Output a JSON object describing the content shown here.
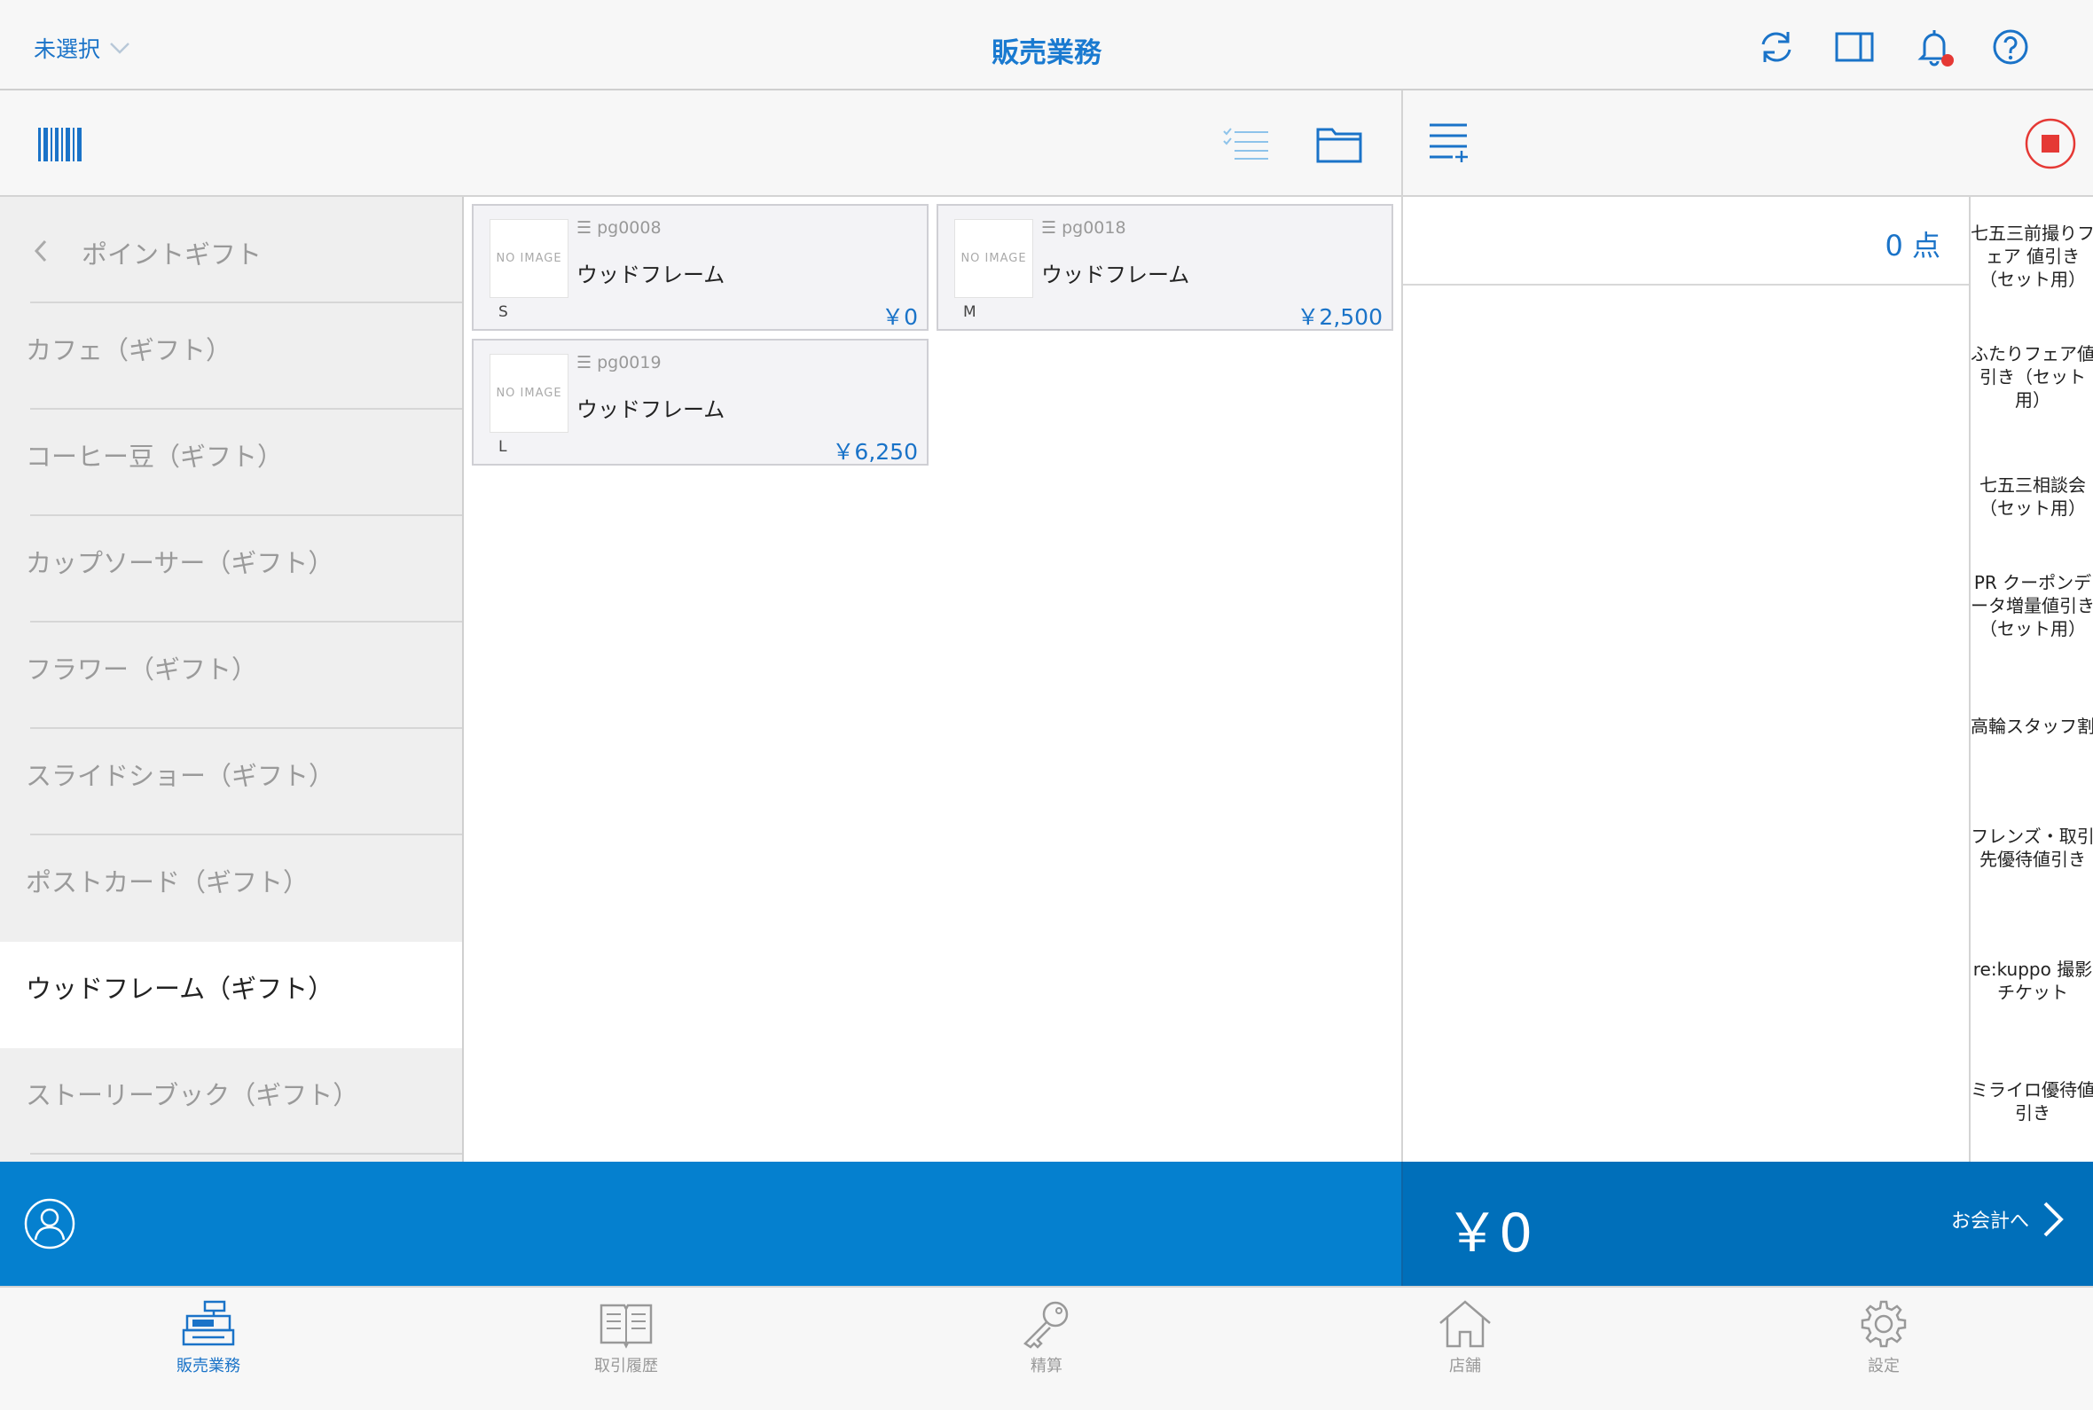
{
  "header": {
    "store_selector": "未選択",
    "title": "販売業務"
  },
  "categories": {
    "back_label": "ポイントギフト",
    "items": [
      {
        "label": "カフェ（ギフト）",
        "selected": false
      },
      {
        "label": "コーヒー豆（ギフト）",
        "selected": false
      },
      {
        "label": "カップソーサー（ギフト）",
        "selected": false
      },
      {
        "label": "フラワー（ギフト）",
        "selected": false
      },
      {
        "label": "スライドショー（ギフト）",
        "selected": false
      },
      {
        "label": "ポストカード（ギフト）",
        "selected": false
      },
      {
        "label": "ウッドフレーム（ギフト）",
        "selected": true
      },
      {
        "label": "ストーリーブック（ギフト）",
        "selected": false
      }
    ]
  },
  "products": [
    {
      "code": "pg0008",
      "name": "ウッドフレーム",
      "size": "S",
      "price": "￥0",
      "image": "NO IMAGE"
    },
    {
      "code": "pg0018",
      "name": "ウッドフレーム",
      "size": "M",
      "price": "￥2,500",
      "image": "NO IMAGE"
    },
    {
      "code": "pg0019",
      "name": "ウッドフレーム",
      "size": "L",
      "price": "￥6,250",
      "image": "NO IMAGE"
    }
  ],
  "cart": {
    "count": "0 点",
    "total": "￥0",
    "checkout_label": "お会計へ"
  },
  "discounts": [
    "七五三前撮りフェア 値引き（セット用）",
    "ふたりフェア値引き（セット用）",
    "七五三相談会（セット用）",
    "PR クーポンデータ増量値引き（セット用）",
    "高輪スタッフ割",
    "フレンズ・取引先優待値引き",
    "re:kuppo 撮影チケット",
    "ミライロ優待値引き"
  ],
  "tabs": [
    {
      "label": "販売業務",
      "icon": "register-icon",
      "active": true
    },
    {
      "label": "取引履歴",
      "icon": "book-icon",
      "active": false
    },
    {
      "label": "精算",
      "icon": "key-icon",
      "active": false
    },
    {
      "label": "店舗",
      "icon": "home-icon",
      "active": false
    },
    {
      "label": "設定",
      "icon": "gear-icon",
      "active": false
    }
  ],
  "colors": {
    "accent": "#1a73c8",
    "bar_blue": "#0580cf",
    "bar_dark_blue": "#006fba",
    "alert_red": "#e53935"
  }
}
